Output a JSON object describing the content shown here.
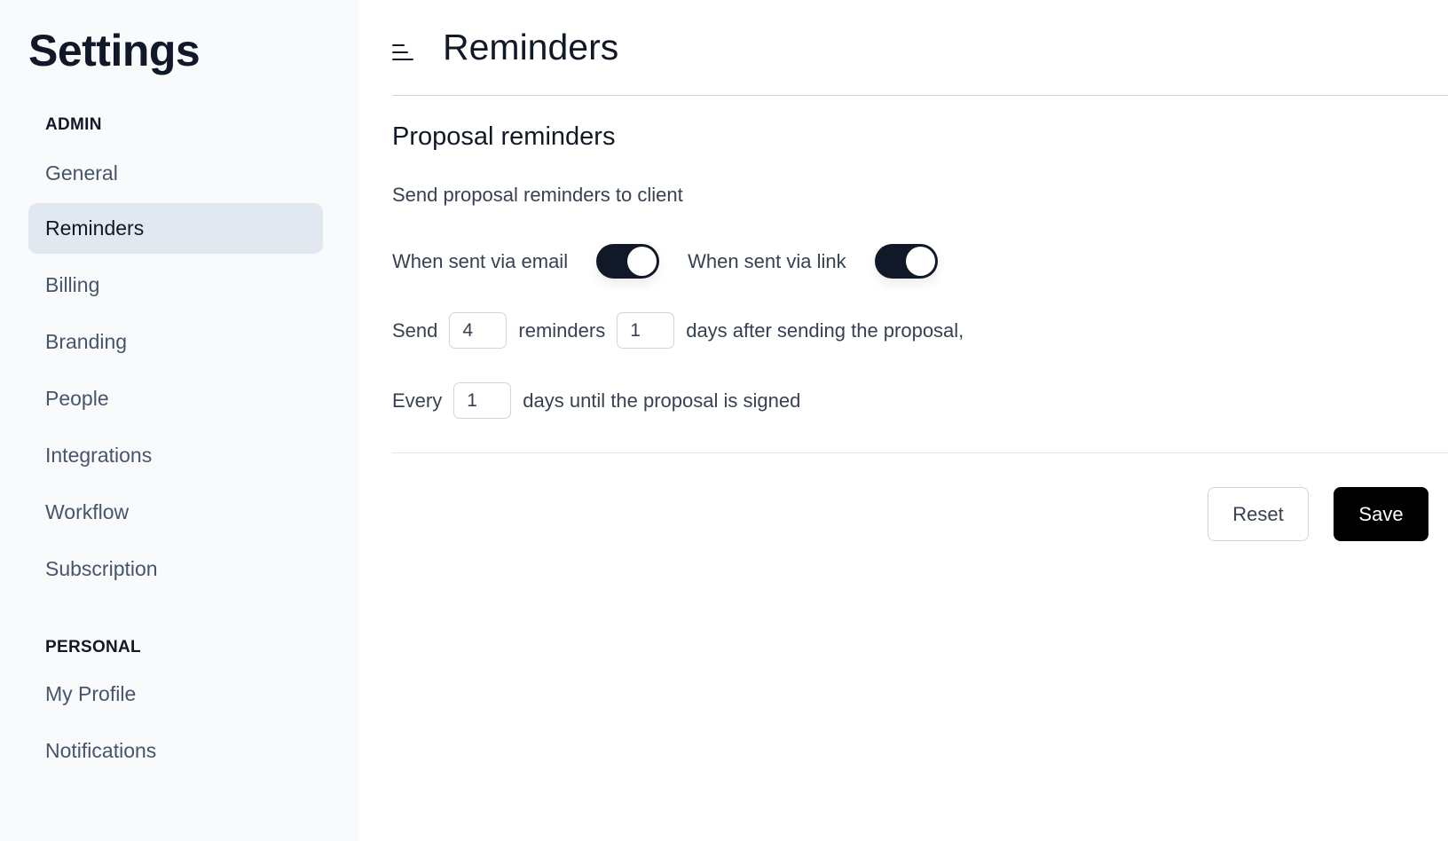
{
  "sidebar": {
    "title": "Settings",
    "sections": [
      {
        "label": "ADMIN",
        "items": [
          {
            "label": "General",
            "active": false
          },
          {
            "label": "Reminders",
            "active": true
          },
          {
            "label": "Billing",
            "active": false
          },
          {
            "label": "Branding",
            "active": false
          },
          {
            "label": "People",
            "active": false
          },
          {
            "label": "Integrations",
            "active": false
          },
          {
            "label": "Workflow",
            "active": false
          },
          {
            "label": "Subscription",
            "active": false
          }
        ]
      },
      {
        "label": "PERSONAL",
        "items": [
          {
            "label": "My Profile",
            "active": false
          },
          {
            "label": "Notifications",
            "active": false
          }
        ]
      }
    ]
  },
  "header": {
    "menu_icon": "menu-icon",
    "title": "Reminders"
  },
  "proposal": {
    "section_title": "Proposal reminders",
    "description": "Send proposal reminders to client",
    "toggles": [
      {
        "label": "When sent via email",
        "on": true
      },
      {
        "label": "When sent via link",
        "on": true
      }
    ],
    "send_row": {
      "prefix": "Send",
      "count_value": "4",
      "middle": "reminders",
      "days_value": "1",
      "suffix": "days after sending the proposal,"
    },
    "every_row": {
      "prefix": "Every",
      "interval_value": "1",
      "suffix": "days until the proposal is signed"
    }
  },
  "actions": {
    "reset_label": "Reset",
    "save_label": "Save"
  },
  "colors": {
    "accent": "#111827",
    "sidebar_bg": "#f8fafc",
    "active_item_bg": "#e2e8f0",
    "save_bg": "#000000"
  }
}
